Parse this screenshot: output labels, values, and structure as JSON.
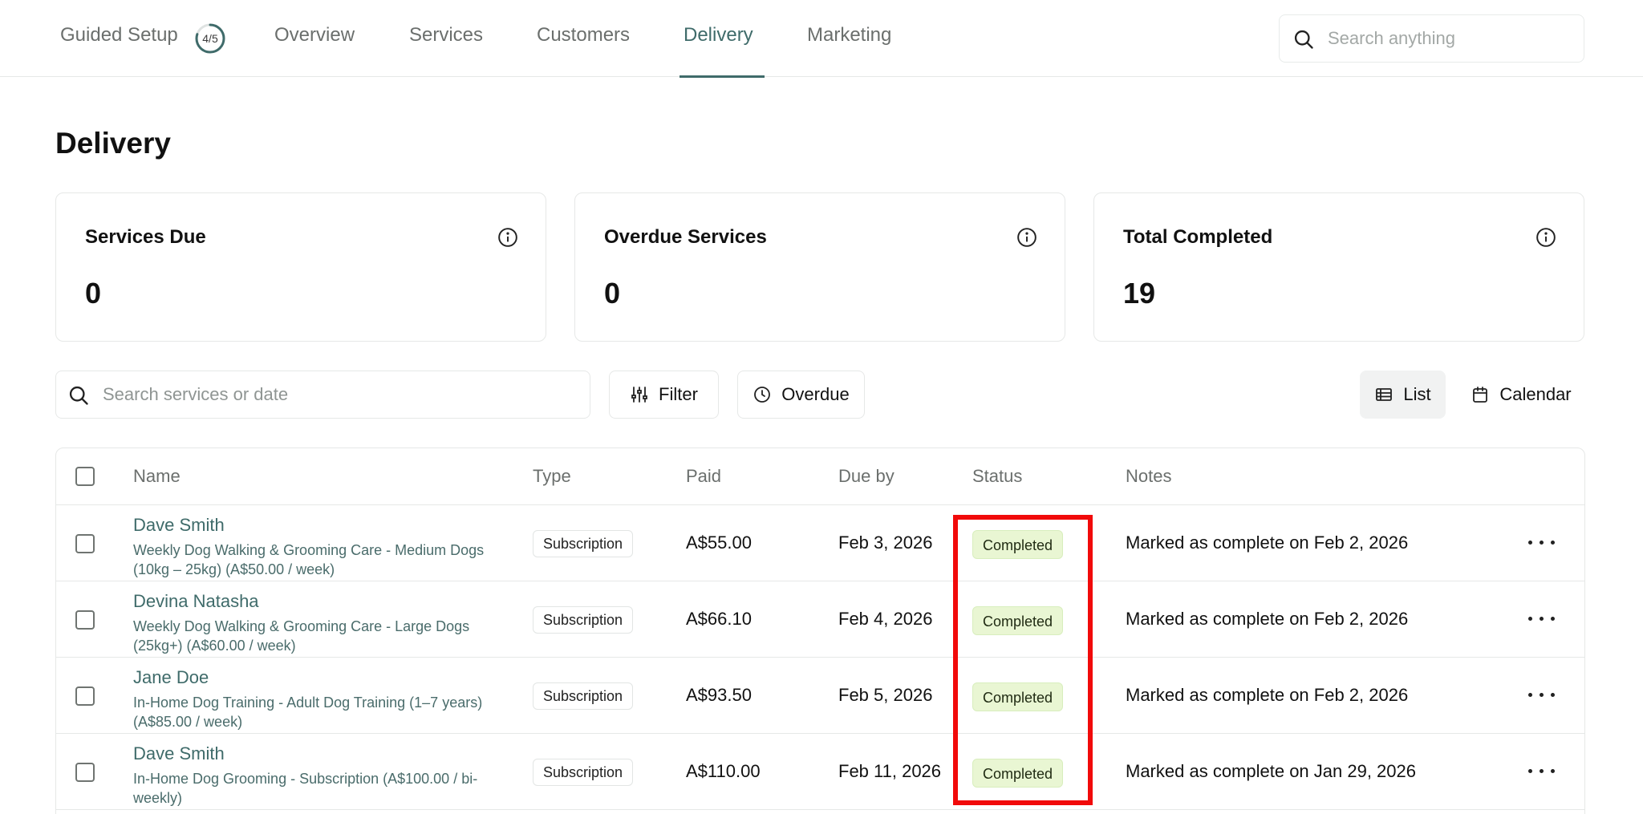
{
  "nav": {
    "guided_setup": "Guided Setup",
    "progress": "4/5",
    "progress_fraction": 0.8,
    "tabs": [
      {
        "label": "Overview"
      },
      {
        "label": "Services"
      },
      {
        "label": "Customers"
      },
      {
        "label": "Delivery",
        "active": true
      },
      {
        "label": "Marketing"
      }
    ],
    "search_placeholder": "Search anything"
  },
  "page": {
    "title": "Delivery"
  },
  "stats": [
    {
      "label": "Services Due",
      "value": "0"
    },
    {
      "label": "Overdue Services",
      "value": "0"
    },
    {
      "label": "Total Completed",
      "value": "19"
    }
  ],
  "toolbar": {
    "search_placeholder": "Search services or date",
    "filter_label": "Filter",
    "overdue_label": "Overdue",
    "list_label": "List",
    "calendar_label": "Calendar",
    "active_view": "List"
  },
  "table": {
    "columns": [
      "Name",
      "Type",
      "Paid",
      "Due by",
      "Status",
      "Notes"
    ],
    "rows": [
      {
        "name": "Dave Smith",
        "service": "Weekly Dog Walking & Grooming Care - Medium Dogs (10kg – 25kg) (A$50.00 / week)",
        "type": "Subscription",
        "paid": "A$55.00",
        "due": "Feb 3, 2026",
        "status": "Completed",
        "notes": "Marked as complete on Feb 2, 2026"
      },
      {
        "name": "Devina Natasha",
        "service": "Weekly Dog Walking & Grooming Care - Large Dogs (25kg+) (A$60.00 / week)",
        "type": "Subscription",
        "paid": "A$66.10",
        "due": "Feb 4, 2026",
        "status": "Completed",
        "notes": "Marked as complete on Feb 2, 2026"
      },
      {
        "name": "Jane Doe",
        "service": "In-Home Dog Training - Adult Dog Training (1–7 years) (A$85.00 / week)",
        "type": "Subscription",
        "paid": "A$93.50",
        "due": "Feb 5, 2026",
        "status": "Completed",
        "notes": "Marked as complete on Feb 2, 2026"
      },
      {
        "name": "Dave Smith",
        "service": "In-Home Dog Grooming - Subscription (A$100.00 / bi-weekly)",
        "type": "Subscription",
        "paid": "A$110.00",
        "due": "Feb 11, 2026",
        "status": "Completed",
        "notes": "Marked as complete on Jan 29, 2026"
      }
    ]
  },
  "colors": {
    "accent": "#3f6b6a",
    "status_completed_bg": "#e9f6d3",
    "highlight": "#f10a0a"
  },
  "icons": {
    "search": "search-icon",
    "info": "info-icon",
    "filter": "sliders-icon",
    "overdue": "clock-icon",
    "list": "list-icon",
    "calendar": "calendar-icon",
    "more": "more-horizontal-icon"
  }
}
